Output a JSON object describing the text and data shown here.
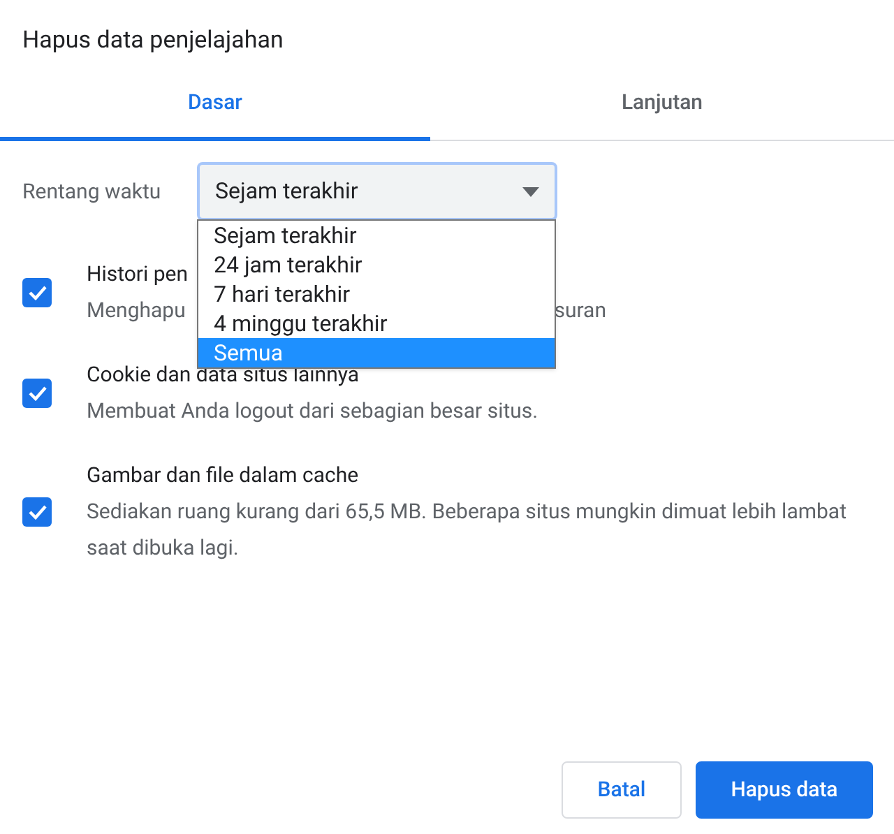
{
  "dialog": {
    "title": "Hapus data penjelajahan"
  },
  "tabs": [
    {
      "label": "Dasar",
      "selected": true
    },
    {
      "label": "Lanjutan",
      "selected": false
    }
  ],
  "time_range": {
    "label": "Rentang waktu",
    "value": "Sejam terakhir",
    "expanded": true,
    "options": [
      {
        "label": "Sejam terakhir",
        "highlighted": false
      },
      {
        "label": "24 jam terakhir",
        "highlighted": false
      },
      {
        "label": "7 hari terakhir",
        "highlighted": false
      },
      {
        "label": "4 minggu terakhir",
        "highlighted": false
      },
      {
        "label": "Semua",
        "highlighted": true
      }
    ]
  },
  "items": [
    {
      "title": "Histori pen",
      "description_parts": [
        "Menghapu",
        "suran"
      ],
      "checked": true
    },
    {
      "title": "Cookie dan data situs lainnya",
      "description_parts": [
        "Membuat Anda logout dari sebagian besar situs."
      ],
      "checked": true
    },
    {
      "title": "Gambar dan file dalam cache",
      "description_parts": [
        "Sediakan ruang kurang dari 65,5 MB. Beberapa situs mungkin dimuat lebih lambat saat dibuka lagi."
      ],
      "checked": true
    }
  ],
  "buttons": [
    {
      "label": "Batal",
      "kind": "secondary"
    },
    {
      "label": "Hapus data",
      "kind": "primary"
    }
  ]
}
